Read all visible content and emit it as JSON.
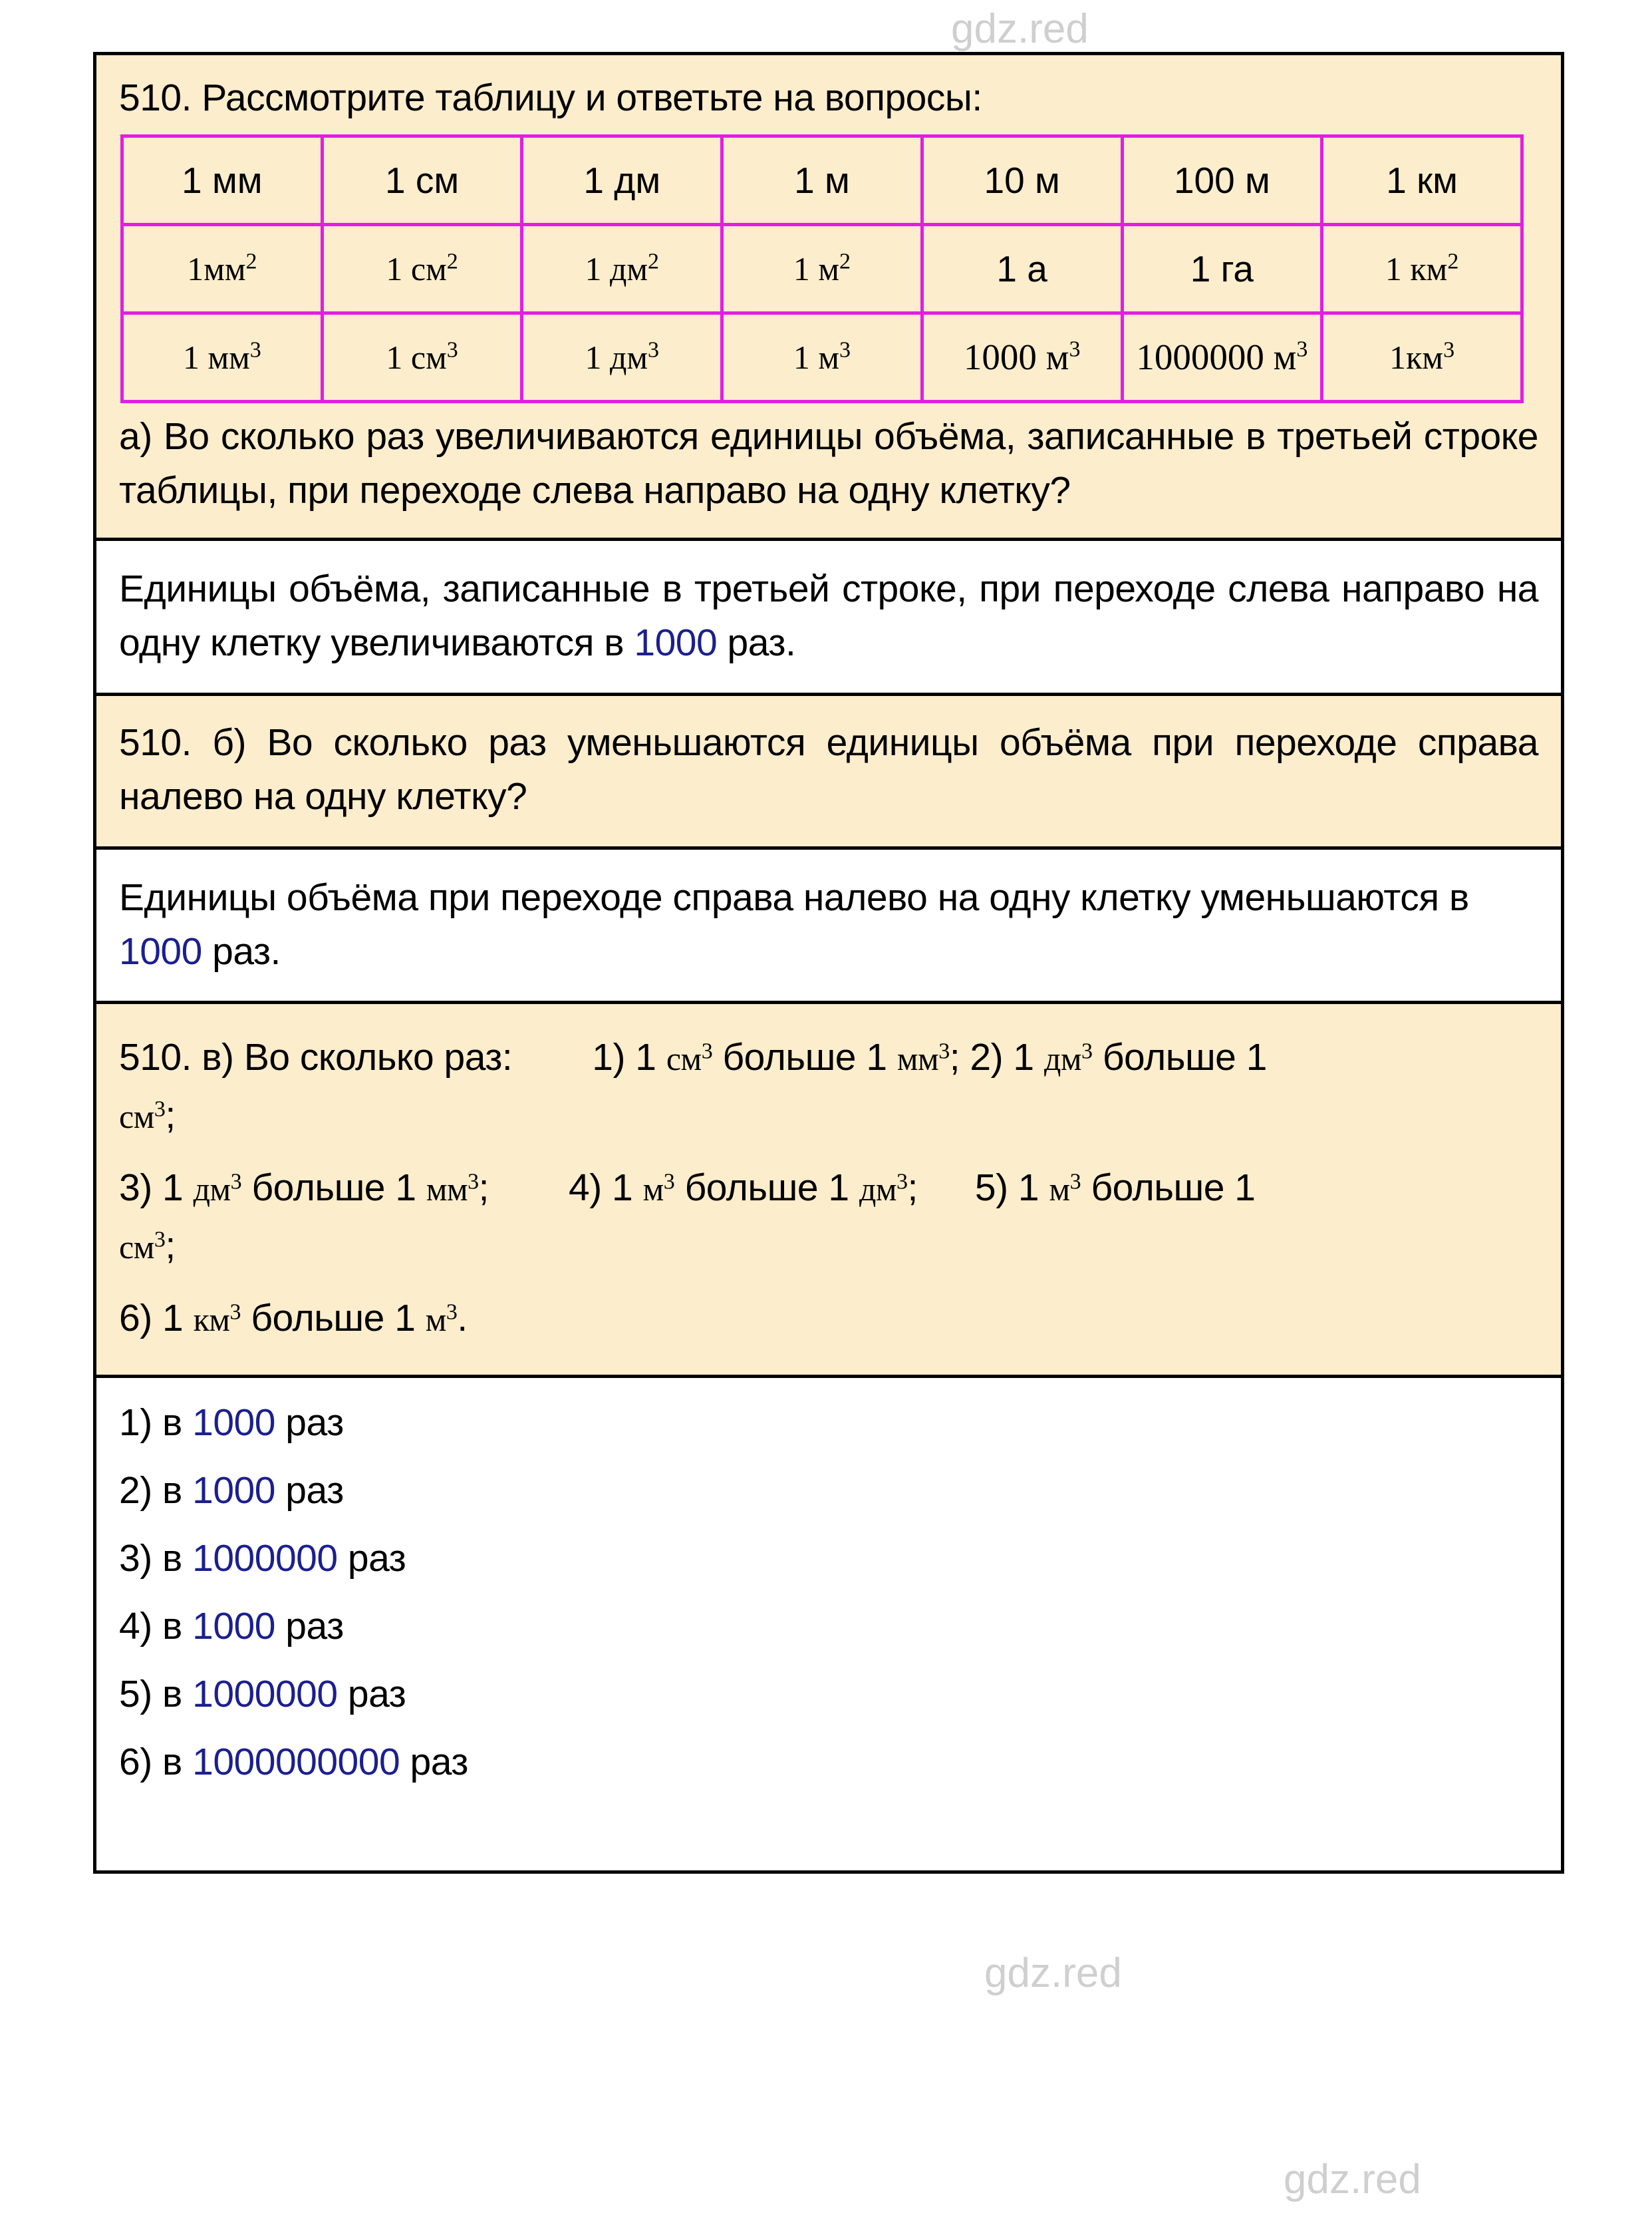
{
  "watermark": {
    "text": "gdz.red"
  },
  "colors": {
    "page_background": "#ffffff",
    "question_background": "#fcedcc",
    "answer_background": "#ffffff",
    "border": "#000000",
    "table_border": "#e21ee2",
    "highlight_number": "#1b1f8f",
    "watermark": "#cfcfcf"
  },
  "task_a": {
    "title": "510. Рассмотрите таблицу и ответьте на вопросы:",
    "table": {
      "rows": [
        {
          "id": "length",
          "cells": [
            {
              "text": "1 мм",
              "exp": ""
            },
            {
              "text": "1 см",
              "exp": ""
            },
            {
              "text": "1 дм",
              "exp": ""
            },
            {
              "text": "1 м",
              "exp": ""
            },
            {
              "text": "10 м",
              "exp": ""
            },
            {
              "text": "100 м",
              "exp": ""
            },
            {
              "text": "1 км",
              "exp": ""
            }
          ]
        },
        {
          "id": "area",
          "cells": [
            {
              "text": "1мм",
              "exp": "2"
            },
            {
              "text": "1 см",
              "exp": "2"
            },
            {
              "text": "1 дм",
              "exp": "2"
            },
            {
              "text": "1 м",
              "exp": "2"
            },
            {
              "text": "1 а",
              "exp": ""
            },
            {
              "text": "1 га",
              "exp": ""
            },
            {
              "text": "1 км",
              "exp": "2"
            }
          ]
        },
        {
          "id": "volume",
          "cells": [
            {
              "text": "1 мм",
              "exp": "3"
            },
            {
              "text": "1 см",
              "exp": "3"
            },
            {
              "text": "1 дм",
              "exp": "3"
            },
            {
              "text": "1 м",
              "exp": "3"
            },
            {
              "text": "1000 м",
              "exp": "3"
            },
            {
              "text": "1000000 м",
              "exp": "3"
            },
            {
              "text": "1км",
              "exp": "3"
            }
          ]
        }
      ]
    },
    "question": "а) Во сколько раз увеличиваются единицы объёма, записанные в третьей строке таблицы, при переходе слева направо на одну клетку?"
  },
  "answer_a": {
    "part1": "Единицы объёма, записанные в третьей строке, при переходе слева направо на одну клетку увеличиваются в ",
    "value": "1000",
    "part2": " раз."
  },
  "task_b": {
    "question": "510. б) Во сколько раз уменьшаются единицы объёма при переходе справа налево на одну клетку?"
  },
  "answer_b": {
    "part1": "Единицы объёма при переходе справа налево на одну клетку уменьшаются в ",
    "value": "1000",
    "part2": " раз."
  },
  "task_c": {
    "lead": "510. в) Во сколько раз:",
    "items": [
      {
        "label": "1)",
        "left_n": "1",
        "left_u": "см",
        "left_exp": "3",
        "verb": "больше",
        "right_n": "1",
        "right_u": "мм",
        "right_exp": "3",
        "end": ";"
      },
      {
        "label": "2)",
        "left_n": "1",
        "left_u": "дм",
        "left_exp": "3",
        "verb": "больше",
        "right_n": "1",
        "right_u": "см",
        "right_exp": "3",
        "end": ";"
      },
      {
        "label": "3)",
        "left_n": "1",
        "left_u": "дм",
        "left_exp": "3",
        "verb": "больше",
        "right_n": "1",
        "right_u": "мм",
        "right_exp": "3",
        "end": ";"
      },
      {
        "label": "4)",
        "left_n": "1",
        "left_u": "м",
        "left_exp": "3",
        "verb": "больше",
        "right_n": "1",
        "right_u": "дм",
        "right_exp": "3",
        "end": ";"
      },
      {
        "label": "5)",
        "left_n": "1",
        "left_u": "м",
        "left_exp": "3",
        "verb": "больше",
        "right_n": "1",
        "right_u": "см",
        "right_exp": "3",
        "end": ";"
      },
      {
        "label": "6)",
        "left_n": "1",
        "left_u": "км",
        "left_exp": "3",
        "verb": "больше",
        "right_n": "1",
        "right_u": "м",
        "right_exp": "3",
        "end": "."
      }
    ]
  },
  "answers_c": {
    "items": [
      {
        "label": "1)",
        "prefix": "в ",
        "value": "1000",
        "suffix": " раз"
      },
      {
        "label": "2)",
        "prefix": "в ",
        "value": "1000",
        "suffix": " раз"
      },
      {
        "label": "3)",
        "prefix": "в ",
        "value": "1000000",
        "suffix": " раз"
      },
      {
        "label": "4)",
        "prefix": "в ",
        "value": "1000",
        "suffix": " раз"
      },
      {
        "label": "5)",
        "prefix": "в ",
        "value": "1000000",
        "suffix": " раз"
      },
      {
        "label": "6)",
        "prefix": "в ",
        "value": "1000000000",
        "suffix": " раз"
      }
    ]
  }
}
